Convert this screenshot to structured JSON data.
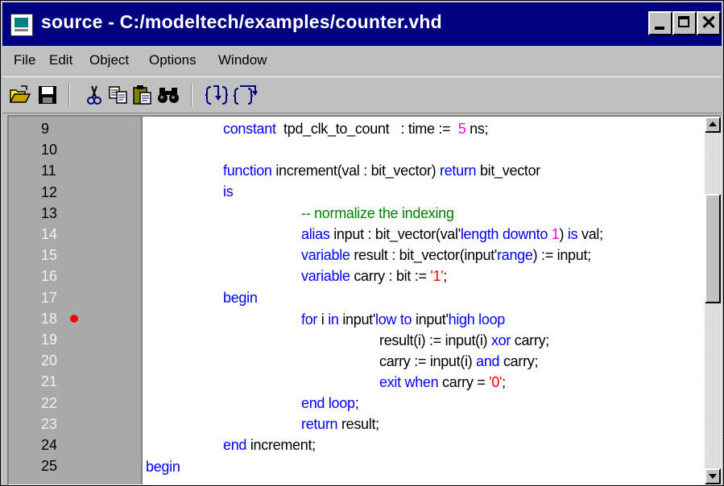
{
  "window": {
    "title": "source - C:/modeltech/examples/counter.vhd",
    "close_glyph": "✕"
  },
  "menu": [
    {
      "label": "File"
    },
    {
      "label": "Edit"
    },
    {
      "label": "Object"
    },
    {
      "label": "Options"
    },
    {
      "label": "Window"
    }
  ],
  "toolbar": {
    "icons": [
      "open-folder-icon",
      "save-disk-icon",
      "cut-scissors-icon",
      "copy-icon",
      "paste-icon",
      "find-binoculars-icon",
      "step-icon",
      "step-over-icon"
    ]
  },
  "editor": {
    "line_numbers": [
      "9",
      "10",
      "11",
      "12",
      "13",
      "14",
      "15",
      "16",
      "17",
      "18",
      "19",
      "20",
      "21",
      "22",
      "23",
      "24",
      "25"
    ],
    "breakpoint_line": "18",
    "breakpoint_color": "#ff0000",
    "colors": {
      "keyword": "#0000ff",
      "comment": "#008000",
      "number": "#ff00ff",
      "string": "#ff0000",
      "text": "#000000"
    },
    "lines": [
      [
        {
          "t": "constant",
          "k": "kw"
        },
        {
          "t": "  tpd_clk_to_count   : time :=  ",
          "k": "tx"
        },
        {
          "t": "5",
          "k": "num"
        },
        {
          "t": " ns;",
          "k": "tx"
        }
      ],
      [],
      [
        {
          "t": "function",
          "k": "kw"
        },
        {
          "t": " increment(val : bit_vector) ",
          "k": "tx"
        },
        {
          "t": "return",
          "k": "kw"
        },
        {
          "t": " bit_vector",
          "k": "tx"
        }
      ],
      [
        {
          "t": "is",
          "k": "kw"
        }
      ],
      [
        {
          "t": "-- normalize the indexing",
          "k": "cm"
        }
      ],
      [
        {
          "t": "alias",
          "k": "kw"
        },
        {
          "t": " input : bit_vector(val'",
          "k": "tx"
        },
        {
          "t": "length",
          "k": "kw"
        },
        {
          "t": " ",
          "k": "tx"
        },
        {
          "t": "downto",
          "k": "kw"
        },
        {
          "t": " ",
          "k": "tx"
        },
        {
          "t": "1",
          "k": "num"
        },
        {
          "t": ") ",
          "k": "tx"
        },
        {
          "t": "is",
          "k": "kw"
        },
        {
          "t": " val;",
          "k": "tx"
        }
      ],
      [
        {
          "t": "variable",
          "k": "kw"
        },
        {
          "t": " result : bit_vector(input'",
          "k": "tx"
        },
        {
          "t": "range",
          "k": "kw"
        },
        {
          "t": ") := input;",
          "k": "tx"
        }
      ],
      [
        {
          "t": "variable",
          "k": "kw"
        },
        {
          "t": " carry : bit := ",
          "k": "tx"
        },
        {
          "t": "'1'",
          "k": "str"
        },
        {
          "t": ";",
          "k": "tx"
        }
      ],
      [
        {
          "t": "begin",
          "k": "kw"
        }
      ],
      [
        {
          "t": "for",
          "k": "kw"
        },
        {
          "t": " i ",
          "k": "tx"
        },
        {
          "t": "in",
          "k": "kw"
        },
        {
          "t": " input'",
          "k": "tx"
        },
        {
          "t": "low",
          "k": "kw"
        },
        {
          "t": " ",
          "k": "tx"
        },
        {
          "t": "to",
          "k": "kw"
        },
        {
          "t": " input'",
          "k": "tx"
        },
        {
          "t": "high",
          "k": "kw"
        },
        {
          "t": " ",
          "k": "tx"
        },
        {
          "t": "loop",
          "k": "kw"
        }
      ],
      [
        {
          "t": "result(i) := input(i) ",
          "k": "tx"
        },
        {
          "t": "xor",
          "k": "kw"
        },
        {
          "t": " carry;",
          "k": "tx"
        }
      ],
      [
        {
          "t": "carry := input(i) ",
          "k": "tx"
        },
        {
          "t": "and",
          "k": "kw"
        },
        {
          "t": " carry;",
          "k": "tx"
        }
      ],
      [
        {
          "t": "exit",
          "k": "kw"
        },
        {
          "t": " ",
          "k": "tx"
        },
        {
          "t": "when",
          "k": "kw"
        },
        {
          "t": " carry = ",
          "k": "tx"
        },
        {
          "t": "'0'",
          "k": "str"
        },
        {
          "t": ";",
          "k": "tx"
        }
      ],
      [
        {
          "t": "end",
          "k": "kw"
        },
        {
          "t": " ",
          "k": "tx"
        },
        {
          "t": "loop",
          "k": "kw"
        },
        {
          "t": ";",
          "k": "tx"
        }
      ],
      [
        {
          "t": "return",
          "k": "kw"
        },
        {
          "t": " result;",
          "k": "tx"
        }
      ],
      [
        {
          "t": "end",
          "k": "kw"
        },
        {
          "t": " increment;",
          "k": "tx"
        }
      ],
      [
        {
          "t": "begin",
          "k": "kw"
        }
      ]
    ]
  }
}
